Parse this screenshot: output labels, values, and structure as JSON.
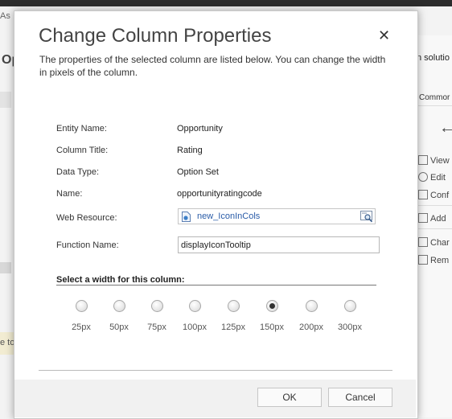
{
  "background": {
    "top_text": "As",
    "left_letters": "Op",
    "right_solution_text": "n solutio",
    "right_common_label": "Commor",
    "right_commands": [
      "View",
      "Edit",
      "Conf",
      "Add",
      "Char",
      "Rem"
    ],
    "yellow_bar_text": "e to"
  },
  "dialog": {
    "title": "Change Column Properties",
    "close_symbol": "✕",
    "description": "The properties of the selected column are listed below. You can change the width in pixels of the column."
  },
  "properties": {
    "entity_name_label": "Entity Name:",
    "entity_name_value": "Opportunity",
    "column_title_label": "Column Title:",
    "column_title_value": "Rating",
    "data_type_label": "Data Type:",
    "data_type_value": "Option Set",
    "name_label": "Name:",
    "name_value": "opportunityratingcode",
    "web_resource_label": "Web Resource:",
    "web_resource_value": "new_IconInCols",
    "function_name_label": "Function Name:",
    "function_name_value": "displayIconTooltip"
  },
  "width_section": {
    "heading": "Select a width for this column:",
    "options": [
      "25px",
      "50px",
      "75px",
      "100px",
      "125px",
      "150px",
      "200px",
      "300px"
    ],
    "selected": "150px"
  },
  "buttons": {
    "ok": "OK",
    "cancel": "Cancel"
  },
  "colors": {
    "link": "#2a5ca8",
    "title": "#444444",
    "footer_bg": "#f1f1f1"
  }
}
